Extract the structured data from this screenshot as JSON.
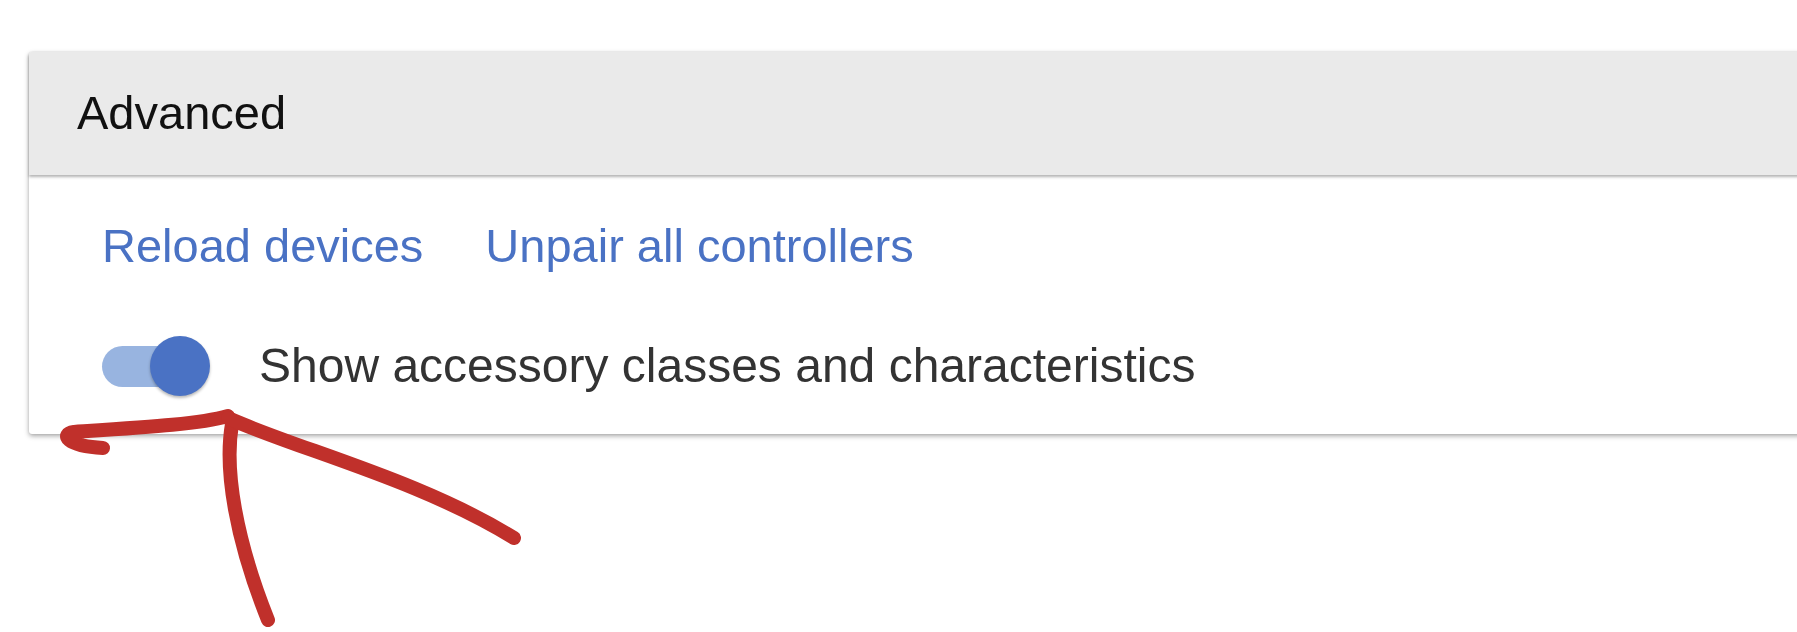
{
  "panel": {
    "title": "Advanced"
  },
  "actions": [
    {
      "label": "Reload devices"
    },
    {
      "label": "Unpair all controllers"
    }
  ],
  "settings": [
    {
      "kind": "toggle",
      "label": "Show accessory classes and characteristics",
      "on": true
    }
  ]
}
